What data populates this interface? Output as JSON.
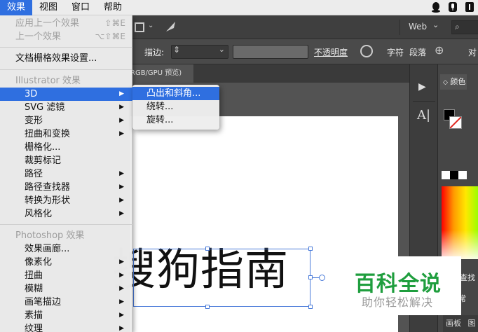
{
  "menubar": {
    "items": [
      "效果",
      "视图",
      "窗口",
      "帮助"
    ],
    "active_index": 0
  },
  "controlbar": {
    "stroke_label": "描边:",
    "opacity_label": "不透明度",
    "char_label": "字符",
    "para_label": "段落",
    "align_label": "对",
    "web_label": "Web"
  },
  "document_tab": {
    "label": "RGB/GPU 预览)"
  },
  "effect_menu": {
    "apply_last": {
      "label": "应用上一个效果",
      "shortcut": "⇧⌘E"
    },
    "last_effect": {
      "label": "上一个效果",
      "shortcut": "⌥⇧⌘E"
    },
    "raster_settings": "文档栅格效果设置...",
    "illustrator_header": "Illustrator 效果",
    "illustrator_items": [
      "3D",
      "SVG 滤镜",
      "变形",
      "扭曲和变换",
      "栅格化...",
      "裁剪标记",
      "路径",
      "路径查找器",
      "转换为形状",
      "风格化"
    ],
    "photoshop_header": "Photoshop 效果",
    "photoshop_items": [
      "效果画廊...",
      "像素化",
      "扭曲",
      "模糊",
      "画笔描边",
      "素描",
      "纹理"
    ]
  },
  "submenu_3d": {
    "items": [
      "凸出和斜角...",
      "绕转...",
      "旋转..."
    ],
    "highlighted_index": 0
  },
  "canvas": {
    "text": "搜狗指南"
  },
  "right_panel": {
    "color_tab": "颜色",
    "find_label": "查找",
    "frequent_label": "常",
    "board_tab": "画板",
    "layer_tab": "图"
  },
  "watermark": {
    "title": "百科全说",
    "subtitle": "助你轻松解决"
  },
  "colors": {
    "menu_highlight": "#2f6fe0",
    "watermark_green": "#1f9e3e"
  }
}
